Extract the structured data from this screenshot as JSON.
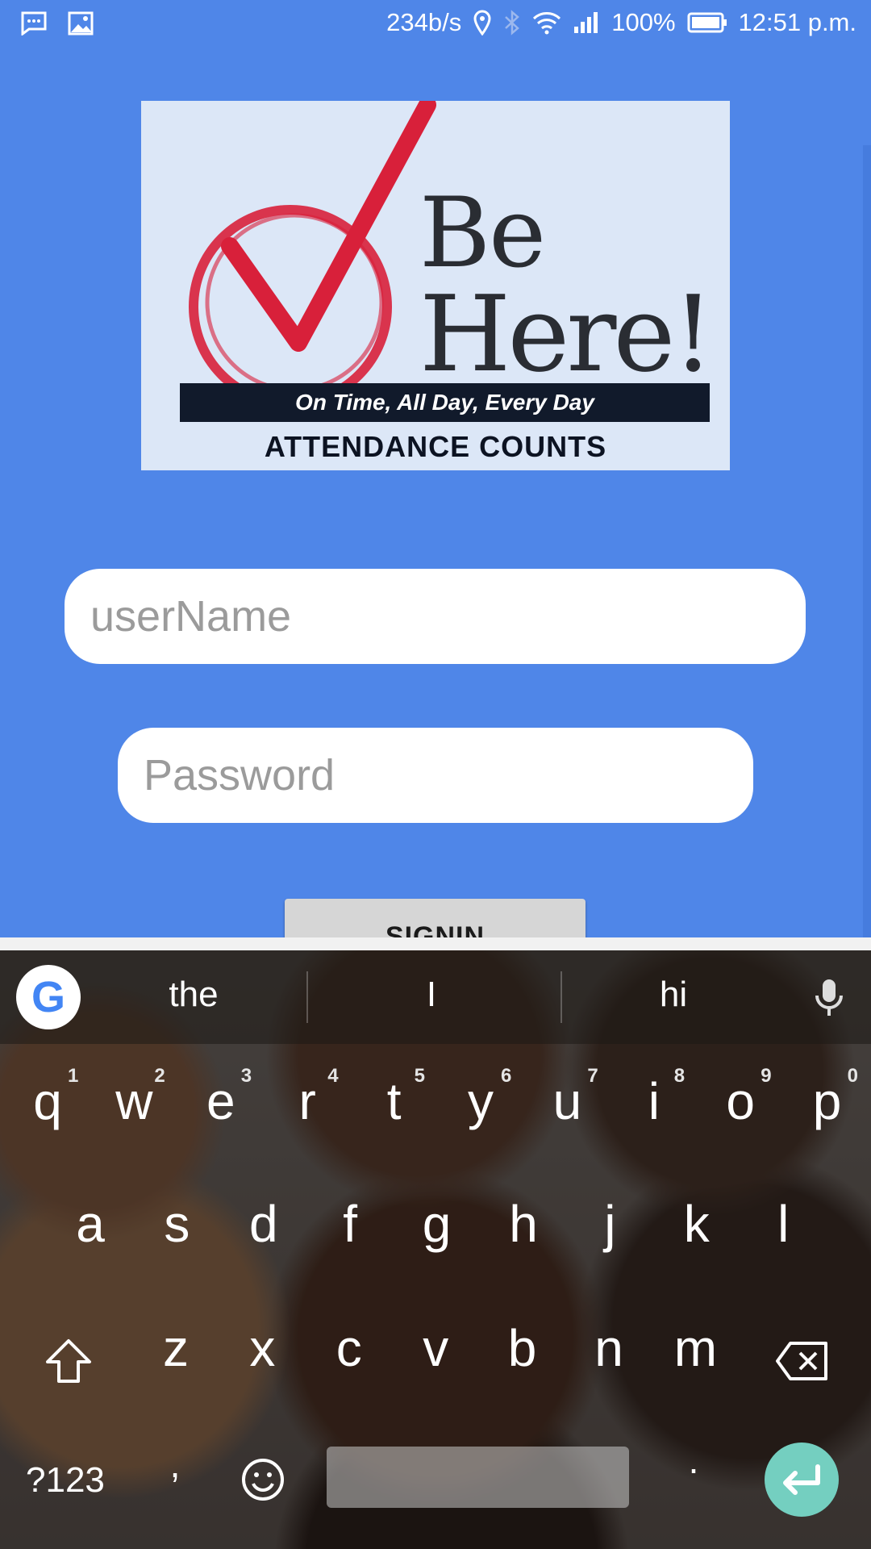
{
  "status_bar": {
    "speed": "234b/s",
    "battery": "100%",
    "time": "12:51 p.m."
  },
  "logo": {
    "line1": "Be",
    "line2": "Here!",
    "tagline": "On Time, All Day, Every Day",
    "subtitle": "ATTENDANCE COUNTS"
  },
  "form": {
    "username_placeholder": "userName",
    "password_placeholder": "Password",
    "signin_label": "SIGNIN"
  },
  "keyboard": {
    "suggestions": [
      "the",
      "I",
      "hi"
    ],
    "row1": [
      "q",
      "w",
      "e",
      "r",
      "t",
      "y",
      "u",
      "i",
      "o",
      "p"
    ],
    "row1_hints": [
      "1",
      "2",
      "3",
      "4",
      "5",
      "6",
      "7",
      "8",
      "9",
      "0"
    ],
    "row2": [
      "a",
      "s",
      "d",
      "f",
      "g",
      "h",
      "j",
      "k",
      "l"
    ],
    "row3": [
      "z",
      "x",
      "c",
      "v",
      "b",
      "n",
      "m"
    ],
    "symbols_label": "?123",
    "comma": ",",
    "period": "."
  },
  "colors": {
    "background": "#4f86e8",
    "enter_key": "#74cfc0",
    "logo_check": "#d8203a"
  }
}
